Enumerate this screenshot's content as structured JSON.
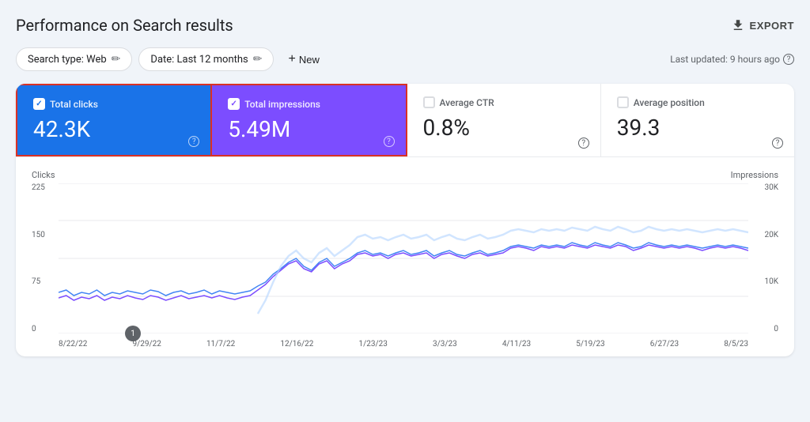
{
  "header": {
    "title": "Performance on Search results",
    "export_label": "EXPORT"
  },
  "filters": {
    "search_type_label": "Search type: Web",
    "date_label": "Date: Last 12 months",
    "new_label": "New",
    "last_updated": "Last updated: 9 hours ago"
  },
  "metrics": [
    {
      "id": "total-clicks",
      "label": "Total clicks",
      "value": "42.3K",
      "active": true,
      "style": "blue"
    },
    {
      "id": "total-impressions",
      "label": "Total impressions",
      "value": "5.49M",
      "active": true,
      "style": "purple"
    },
    {
      "id": "average-ctr",
      "label": "Average CTR",
      "value": "0.8%",
      "active": false,
      "style": "none"
    },
    {
      "id": "average-position",
      "label": "Average position",
      "value": "39.3",
      "active": false,
      "style": "none"
    }
  ],
  "chart": {
    "left_axis_label": "Clicks",
    "right_axis_label": "Impressions",
    "left_ticks": [
      "225",
      "150",
      "75",
      "0"
    ],
    "right_ticks": [
      "30K",
      "20K",
      "10K",
      "0"
    ],
    "x_labels": [
      "8/22/22",
      "9/29/22",
      "11/7/22",
      "12/16/22",
      "1/23/23",
      "3/3/23",
      "4/11/23",
      "5/19/23",
      "6/27/23",
      "8/5/23"
    ],
    "annotation": "1"
  }
}
